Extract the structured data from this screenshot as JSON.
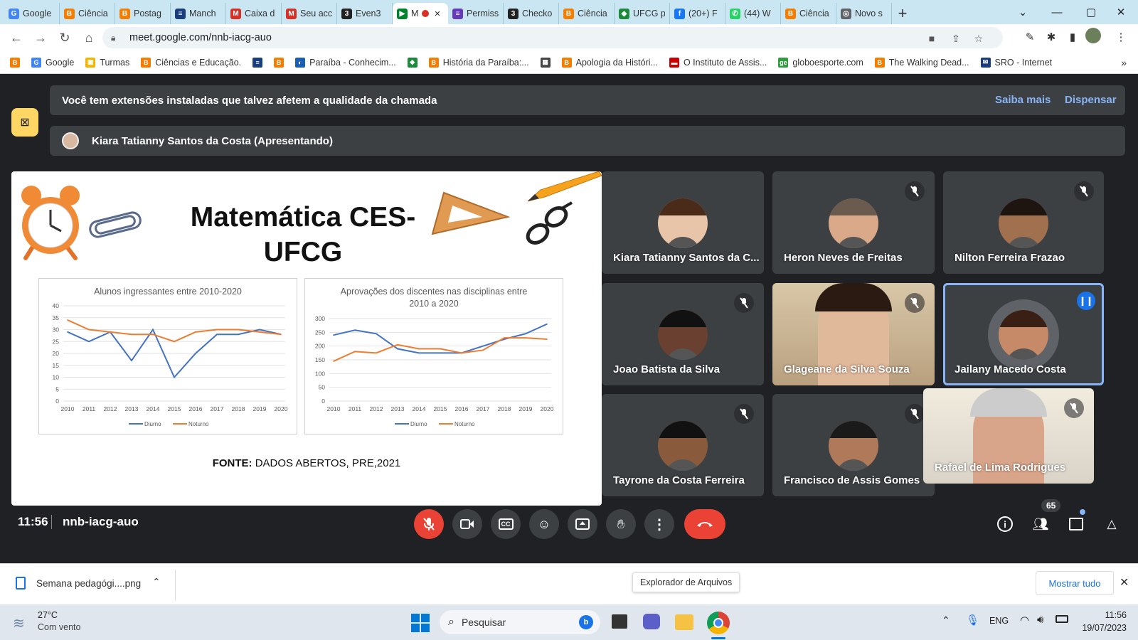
{
  "browser": {
    "tabs": [
      {
        "label": "Google",
        "icon": "google-g-icon",
        "color": "#4285f4",
        "glyph": "G"
      },
      {
        "label": "Ciência",
        "icon": "blogger-icon",
        "color": "#f57d00",
        "glyph": "B"
      },
      {
        "label": "Postag",
        "icon": "blogger-icon",
        "color": "#f57d00",
        "glyph": "B"
      },
      {
        "label": "Manch",
        "icon": "news-icon",
        "color": "#1a3d7c",
        "glyph": "≡"
      },
      {
        "label": "Caixa d",
        "icon": "gmail-icon",
        "color": "#d93025",
        "glyph": "M"
      },
      {
        "label": "Seu acc",
        "icon": "gmail-icon",
        "color": "#d93025",
        "glyph": "M"
      },
      {
        "label": "Even3",
        "icon": "even3-icon",
        "color": "#222222",
        "glyph": "3"
      },
      {
        "label": "M",
        "icon": "meet-icon",
        "color": "#00832d",
        "glyph": "▶",
        "active": true
      },
      {
        "label": "Permiss",
        "icon": "forms-icon",
        "color": "#673ab7",
        "glyph": "≡"
      },
      {
        "label": "Checko",
        "icon": "even3-icon",
        "color": "#222222",
        "glyph": "3"
      },
      {
        "label": "Ciência",
        "icon": "blogger-icon",
        "color": "#f57d00",
        "glyph": "B"
      },
      {
        "label": "UFCG p",
        "icon": "flag-icon",
        "color": "#1b8a3a",
        "glyph": "◆"
      },
      {
        "label": "(20+) F",
        "icon": "facebook-icon",
        "color": "#1877f2",
        "glyph": "f"
      },
      {
        "label": "(44) W",
        "icon": "whatsapp-icon",
        "color": "#25d366",
        "glyph": "✆"
      },
      {
        "label": "Ciência",
        "icon": "blogger-icon",
        "color": "#f57d00",
        "glyph": "B"
      },
      {
        "label": "Novo s",
        "icon": "globe-icon",
        "color": "#5f6368",
        "glyph": "◎"
      }
    ],
    "url": "meet.google.com/nnb-iacg-auo",
    "bookmarks": [
      {
        "label": "",
        "color": "#f57d00",
        "glyph": "B"
      },
      {
        "label": "Google",
        "color": "#4285f4",
        "glyph": "G"
      },
      {
        "label": "Turmas",
        "color": "#f4b400",
        "glyph": "▣"
      },
      {
        "label": "Ciências e Educação.",
        "color": "#f57d00",
        "glyph": "B"
      },
      {
        "label": "",
        "color": "#1a3d7c",
        "glyph": "≡"
      },
      {
        "label": "",
        "color": "#f57d00",
        "glyph": "B"
      },
      {
        "label": "Paraíba - Conhecim...",
        "color": "#1a5fb4",
        "glyph": "◐"
      },
      {
        "label": "",
        "color": "#1b8a3a",
        "glyph": "◆"
      },
      {
        "label": "História da Paraíba:...",
        "color": "#f57d00",
        "glyph": "B"
      },
      {
        "label": "",
        "color": "#444444",
        "glyph": "▦"
      },
      {
        "label": "Apologia da Históri...",
        "color": "#f57d00",
        "glyph": "B"
      },
      {
        "label": "O Instituto de Assis...",
        "color": "#cc0000",
        "glyph": "▬"
      },
      {
        "label": "globoesporte.com",
        "color": "#2e9e3f",
        "glyph": "ge"
      },
      {
        "label": "The Walking Dead...",
        "color": "#f57d00",
        "glyph": "B"
      },
      {
        "label": "SRO - Internet",
        "color": "#1a3d7c",
        "glyph": "✉"
      }
    ],
    "more_bookmarks": "»"
  },
  "meet": {
    "extension_warning": "Você tem extensões instaladas que talvez afetem a qualidade da chamada",
    "learn_more": "Saiba mais",
    "dismiss": "Dispensar",
    "presenter_banner": "Kiara Tatianny Santos da Costa (Apresentando)",
    "time": "11:56",
    "meeting_code": "nnb-iacg-auo",
    "participant_count": "65",
    "participants": [
      {
        "name": "Kiara Tatianny Santos da C...",
        "muted": false,
        "skin": "#e8c4a8",
        "hair": "#4a2a18"
      },
      {
        "name": "Heron Neves de Freitas",
        "muted": true,
        "skin": "#d9a98a",
        "hair": "#6b5a4e"
      },
      {
        "name": "Nilton Ferreira Frazao",
        "muted": true,
        "skin": "#a0704f",
        "hair": "#1e1410"
      },
      {
        "name": "Joao Batista da Silva",
        "muted": true,
        "skin": "#6a4030",
        "hair": "#111111"
      },
      {
        "name": "Glageane da Silva Souza",
        "muted": true,
        "skin": "#e0b89a",
        "hair": "#2a1a12"
      },
      {
        "name": "Jailany Macedo Costa",
        "muted": false,
        "speaking": true,
        "skin": "#c68a68",
        "hair": "#3a2014"
      },
      {
        "name": "Tayrone da Costa Ferreira",
        "muted": true,
        "skin": "#8a5a3c",
        "hair": "#111111"
      },
      {
        "name": "Francisco de Assis Gomes",
        "muted": true,
        "skin": "#b07a5a",
        "hair": "#1a1a1a"
      },
      {
        "name": "Rafael de Lima Rodrigues",
        "muted": true,
        "skin": "#d8a58a",
        "hair": "#cccccc"
      }
    ]
  },
  "slide": {
    "title_line1": "Matemática CES-",
    "title_line2": "UFCG",
    "source_label": "FONTE:",
    "source_text": " DADOS ABERTOS, PRE,2021"
  },
  "chart_data": [
    {
      "type": "line",
      "title": "Alunos ingressantes entre 2010-2020",
      "x": [
        2010,
        2011,
        2012,
        2013,
        2014,
        2015,
        2016,
        2017,
        2018,
        2019,
        2020
      ],
      "ylim": [
        0,
        40
      ],
      "yticks": [
        0,
        5,
        10,
        15,
        20,
        25,
        30,
        35,
        40
      ],
      "series": [
        {
          "name": "Diurno",
          "color": "#4472c4",
          "values": [
            29,
            25,
            29,
            17,
            30,
            10,
            20,
            28,
            28,
            30,
            28
          ]
        },
        {
          "name": "Noturno",
          "color": "#ed7d31",
          "values": [
            34,
            30,
            29,
            28,
            28,
            25,
            29,
            30,
            30,
            29,
            28
          ]
        }
      ],
      "legend": "bottom"
    },
    {
      "type": "line",
      "title": "Aprovações dos discentes nas disciplinas entre 2010 a 2020",
      "x": [
        2010,
        2011,
        2012,
        2013,
        2014,
        2015,
        2016,
        2017,
        2018,
        2019,
        2020
      ],
      "ylim": [
        0,
        300
      ],
      "yticks": [
        0,
        50,
        100,
        150,
        200,
        250,
        300
      ],
      "series": [
        {
          "name": "Diurno",
          "color": "#4472c4",
          "values": [
            240,
            258,
            245,
            190,
            175,
            175,
            175,
            200,
            225,
            245,
            280
          ]
        },
        {
          "name": "Noturno",
          "color": "#ed7d31",
          "values": [
            145,
            180,
            175,
            205,
            190,
            190,
            175,
            185,
            230,
            230,
            225
          ]
        }
      ],
      "legend": "bottom"
    }
  ],
  "downloads": {
    "file": "Semana pedagógi....png",
    "tooltip": "Explorador de Arquivos",
    "show_all": "Mostrar tudo"
  },
  "taskbar": {
    "temperature": "27°C",
    "weather": "Com vento",
    "search_placeholder": "Pesquisar",
    "language": "ENG",
    "time": "11:56",
    "date": "19/07/2023"
  }
}
